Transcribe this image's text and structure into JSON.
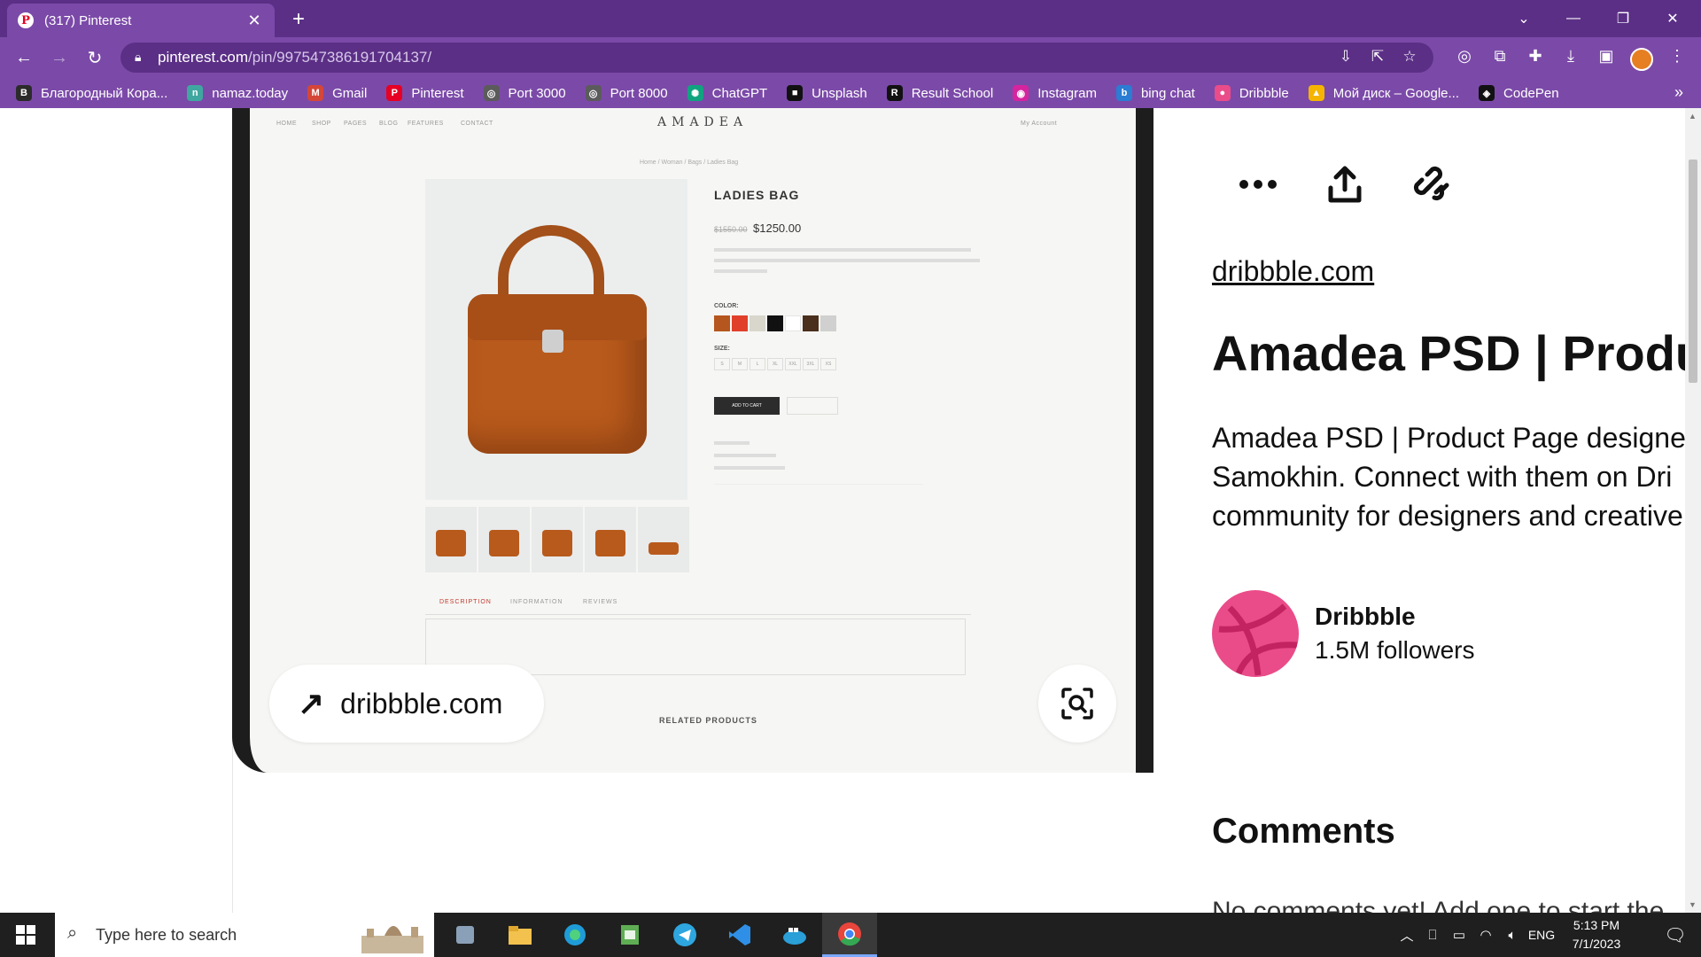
{
  "browser": {
    "tab_title": "(317) Pinterest",
    "url_host": "pinterest.com",
    "url_path": "/pin/997547386191704137/",
    "bookmarks": [
      {
        "label": "Благородный Кора...",
        "color": "#2b2b2b",
        "glyph": "B"
      },
      {
        "label": "namaz.today",
        "color": "#3fa7a0",
        "glyph": "n"
      },
      {
        "label": "Gmail",
        "color": "#d44638",
        "glyph": "M"
      },
      {
        "label": "Pinterest",
        "color": "#e60023",
        "glyph": "P"
      },
      {
        "label": "Port 3000",
        "color": "#5b5b5b",
        "glyph": "◎"
      },
      {
        "label": "Port 8000",
        "color": "#5b5b5b",
        "glyph": "◎"
      },
      {
        "label": "ChatGPT",
        "color": "#10a37f",
        "glyph": "✺"
      },
      {
        "label": "Unsplash",
        "color": "#111111",
        "glyph": "■"
      },
      {
        "label": "Result School",
        "color": "#111111",
        "glyph": "R"
      },
      {
        "label": "Instagram",
        "color": "#d6249f",
        "glyph": "◉"
      },
      {
        "label": "bing chat",
        "color": "#2b7cd3",
        "glyph": "b"
      },
      {
        "label": "Dribbble",
        "color": "#ea4c89",
        "glyph": "●"
      },
      {
        "label": "Мой диск – Google...",
        "color": "#f4b400",
        "glyph": "▲"
      },
      {
        "label": "CodePen",
        "color": "#111111",
        "glyph": "◈"
      }
    ]
  },
  "pin": {
    "image_site": {
      "logo": "AMADEA",
      "nav": [
        "HOME",
        "SHOP",
        "PAGES",
        "BLOG",
        "FEATURES",
        "CONTACT"
      ],
      "account": "My Account",
      "breadcrumb": "Home / Woman / Bags / Ladies Bag",
      "product_title": "LADIES BAG",
      "old_price": "$1550.00",
      "price": "$1250.00",
      "color_label": "COLOR:",
      "size_label": "SIZE:",
      "sizes": [
        "S",
        "M",
        "L",
        "XL",
        "XXL",
        "3XL",
        "XS"
      ],
      "add_to_cart": "ADD TO CART",
      "tabs": [
        "DESCRIPTION",
        "INFORMATION",
        "REVIEWS"
      ],
      "related": "RELATED PRODUCTS",
      "swatches": [
        "#b5561f",
        "#e0402a",
        "#d9d6cc",
        "#111111",
        "#ffffff",
        "#4a2f1c",
        "#d0d0d0"
      ]
    },
    "source_pill": "dribbble.com",
    "source_link": "dribbble.com",
    "title": "Amadea PSD | Product Page",
    "description_lines": [
      "Amadea PSD | Product Page designed",
      "Samokhin. Connect with them on Dri",
      "community for designers and creative"
    ],
    "author": {
      "name": "Dribbble",
      "followers": "1.5M followers"
    },
    "comments_heading": "Comments",
    "comments_cut": "No comments yet! Add one to start the"
  },
  "taskbar": {
    "search_placeholder": "Type here to search",
    "language": "ENG",
    "time": "5:13 PM",
    "date": "7/1/2023"
  }
}
